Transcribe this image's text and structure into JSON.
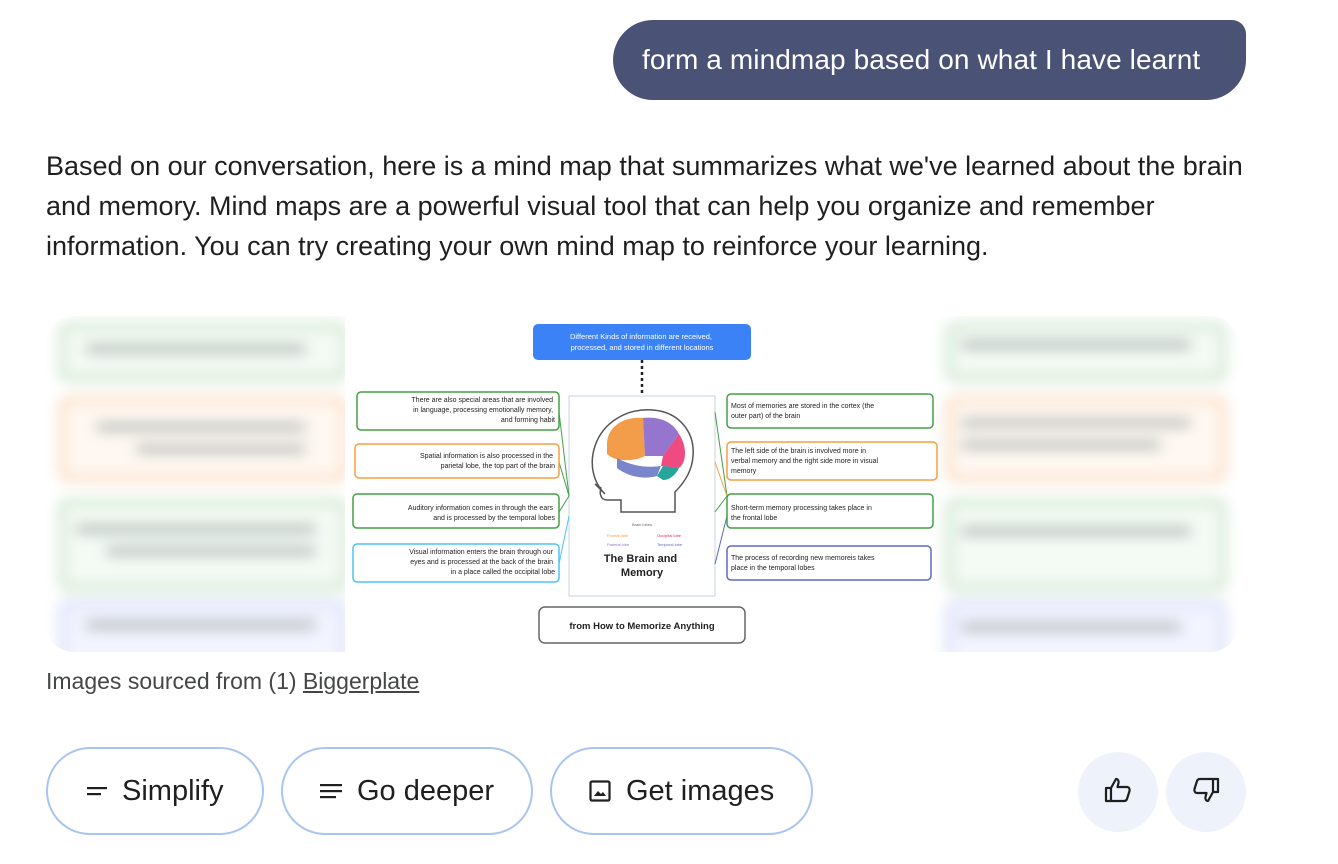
{
  "user_message": "form a mindmap based on what I have learnt",
  "response": {
    "text": "Based on our conversation, here is a mind map that summarizes what we've learned about the brain and memory. Mind maps are a powerful visual tool that can help you organize and remember information. You can try creating your own mind map to reinforce your learning."
  },
  "mindmap_image": {
    "top_box": "Different Kinds of information are received, processed, and stored in different locations",
    "left_boxes": [
      "There are also special areas that are involved in language, processing emotionally memory, and forming habit",
      "Spatial information is also processed in the parietal lobe, the top part of the brain",
      "Auditory information comes in through the ears and is processed by the temporal lobes",
      "Visual information enters the brain through our eyes and is processed at the back of the brain in a place called the occipital lobe"
    ],
    "right_boxes": [
      "Most of memories are stored in the cortex (the outer part) of the brain",
      "The left side of the brain is involved more in verbal memory and the right side more in visual memory",
      "Short-term memory processing takes place in the frontal lobe",
      "The process of recording new memoreis takes place in the temporal lobes"
    ],
    "center_title": "The Brain and Memory",
    "source_box": "from How to Memorize Anything",
    "colors": {
      "blue": "#3b82f6",
      "green": "#43a047",
      "orange": "#f59e42",
      "light_blue": "#4fc3f7",
      "purple": "#5c6bc0"
    }
  },
  "caption": {
    "prefix": "Images sourced from (1) ",
    "link": "Biggerplate"
  },
  "chips": [
    {
      "label": "Simplify",
      "icon": "short-lines-icon"
    },
    {
      "label": "Go deeper",
      "icon": "long-lines-icon"
    },
    {
      "label": "Get images",
      "icon": "image-icon"
    }
  ],
  "feedback": {
    "thumbs_up_icon": "thumbs-up-icon",
    "thumbs_down_icon": "thumbs-down-icon"
  }
}
